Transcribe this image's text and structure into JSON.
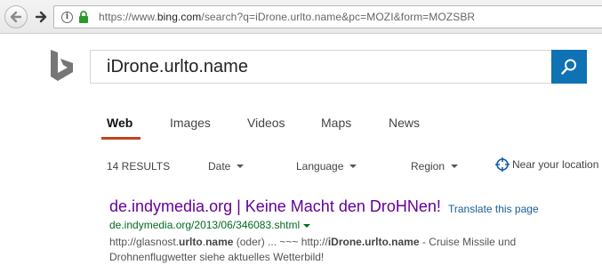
{
  "browser": {
    "url_prefix": "https://www.",
    "url_domain": "bing.com",
    "url_rest": "/search?q=iDrone.urlto.name&pc=MOZI&form=MOZSBR",
    "info_icon": "i"
  },
  "search": {
    "query": "iDrone.urlto.name"
  },
  "tabs": [
    {
      "label": "Web"
    },
    {
      "label": "Images"
    },
    {
      "label": "Videos"
    },
    {
      "label": "Maps"
    },
    {
      "label": "News"
    }
  ],
  "filters": {
    "results_count": "14 RESULTS",
    "date": "Date",
    "language": "Language",
    "region": "Region",
    "near": "Near your location"
  },
  "result": {
    "title": "de.indymedia.org | Keine Macht den DroHNen!",
    "translate": "Translate this page",
    "cite": "de.indymedia.org/2013/06/346083.shtml",
    "snippet": {
      "p1": "http://glasnost.",
      "b1": "urlto",
      "p2": ".",
      "b2": "name",
      "p3": " (oder) ... ~~~ http://",
      "b3": "iDrone.urlto.name",
      "p4": " - Cruise Missile und Drohnenflugwetter siehe aktuelles Wetterbild!"
    }
  },
  "colors": {
    "accent": "#0f72b4",
    "active_tab_underline": "#c1441f",
    "visited_title": "#660099",
    "cite_green": "#006d21",
    "logo": "#767676"
  }
}
